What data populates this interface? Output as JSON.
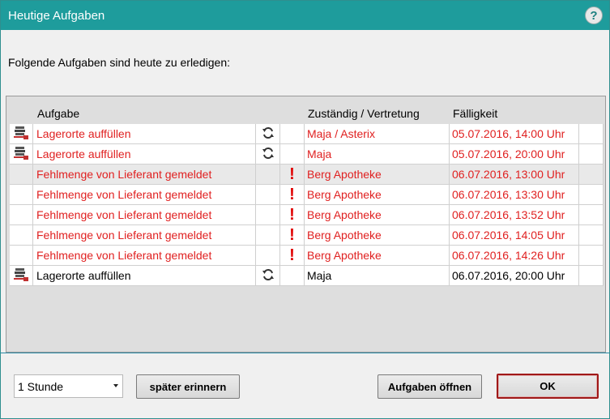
{
  "dialog": {
    "title": "Heutige Aufgaben",
    "help_glyph": "?",
    "subtitle": "Folgende Aufgaben sind heute zu erledigen:"
  },
  "table": {
    "headers": {
      "task": "Aufgabe",
      "responsible": "Zuständig / Vertretung",
      "due": "Fälligkeit"
    },
    "rows": [
      {
        "icon": "storage-icon",
        "task": "Lagerorte auffüllen",
        "recurring": true,
        "priority": false,
        "responsible": "Maja / Asterix",
        "due": "05.07.2016, 14:00 Uhr",
        "overdue": true
      },
      {
        "icon": "storage-icon",
        "task": "Lagerorte auffüllen",
        "recurring": true,
        "priority": false,
        "responsible": "Maja",
        "due": "05.07.2016, 20:00 Uhr",
        "overdue": true
      },
      {
        "icon": "",
        "task": "Fehlmenge von Lieferant gemeldet",
        "recurring": false,
        "priority": true,
        "responsible": "Berg Apotheke",
        "due": "06.07.2016, 13:00 Uhr",
        "overdue": true
      },
      {
        "icon": "",
        "task": "Fehlmenge von Lieferant gemeldet",
        "recurring": false,
        "priority": true,
        "responsible": "Berg Apotheke",
        "due": "06.07.2016, 13:30 Uhr",
        "overdue": true
      },
      {
        "icon": "",
        "task": "Fehlmenge von Lieferant gemeldet",
        "recurring": false,
        "priority": true,
        "responsible": "Berg Apotheke",
        "due": "06.07.2016, 13:52 Uhr",
        "overdue": true
      },
      {
        "icon": "",
        "task": "Fehlmenge von Lieferant gemeldet",
        "recurring": false,
        "priority": true,
        "responsible": "Berg Apotheke",
        "due": "06.07.2016, 14:05 Uhr",
        "overdue": true
      },
      {
        "icon": "",
        "task": "Fehlmenge von Lieferant gemeldet",
        "recurring": false,
        "priority": true,
        "responsible": "Berg Apotheke",
        "due": "06.07.2016, 14:26 Uhr",
        "overdue": true
      },
      {
        "icon": "storage-icon",
        "task": "Lagerorte auffüllen",
        "recurring": true,
        "priority": false,
        "responsible": "Maja",
        "due": "06.07.2016, 20:00 Uhr",
        "overdue": false
      }
    ]
  },
  "footer": {
    "remind_interval": "1 Stunde",
    "later_button": "später erinnern",
    "open_button": "Aufgaben öffnen",
    "ok_button": "OK"
  },
  "colors": {
    "titlebar": "#1e9c9c",
    "overdue_text": "#e02020",
    "priority_mark": "#e00000"
  }
}
